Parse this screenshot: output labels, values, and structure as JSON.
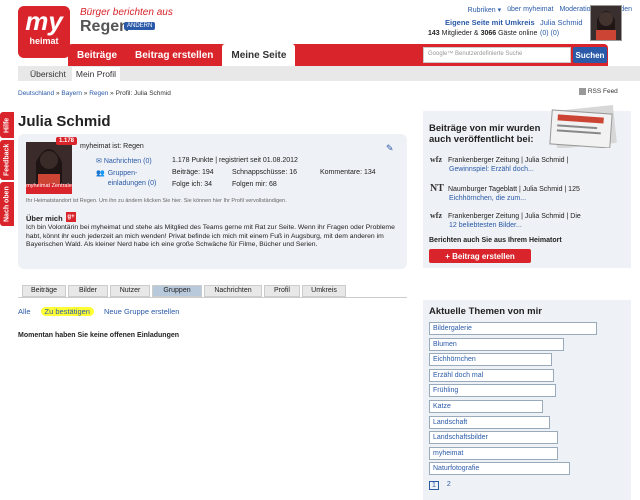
{
  "header": {
    "logo_my": "my",
    "logo_heimat": "heimat",
    "tagline": "Bürger berichten aus",
    "region": "Regen",
    "change_label": "ÄNDERN",
    "topnav": [
      "Rubriken ▾",
      "über myheimat",
      "Moderation",
      "Abmelden"
    ],
    "own_page": "Eigene Seite mit Umkreis",
    "stats_members": "143",
    "stats_members_label": "Mitglieder &",
    "stats_guests": "3066",
    "stats_guests_label": "Gäste online",
    "user_name": "Julia Schmid",
    "user_counts": "(0)   (0)"
  },
  "nav": {
    "items": [
      "Beiträge",
      "Beitrag erstellen",
      "Meine Seite"
    ],
    "active": 2,
    "search_placeholder": "Google™ Benutzerdefinierte Suche",
    "search_button": "Suchen"
  },
  "subnav": {
    "items": [
      "Übersicht",
      "Mein Profil"
    ]
  },
  "sidetabs": [
    "Hilfe",
    "Feedback",
    "Nach oben"
  ],
  "breadcrumb": [
    "Deutschland",
    "Bayern",
    "Regen",
    "Profil: Julia Schmid"
  ],
  "rss": "RSS Feed",
  "profile": {
    "name": "Julia Schmid",
    "badge": "1.178",
    "photo_caption": "myheimat Zentrale",
    "home": "myheimat ist: Regen",
    "messages": "Nachrichten (0)",
    "invites": "Gruppen-\neinladungen (0)",
    "punkte": "1.178 Punkte | registriert seit 01.08.2012",
    "beitraege": "Beiträge: 194",
    "schnapp": "Schnappschüsse: 16",
    "kommentare": "Kommentare: 134",
    "folge": "Folge ich: 34",
    "folgen": "Folgen mir: 68",
    "locinfo": "Ihr Heimatstandort ist Regen. Um ihn zu ändern klicken Sie hier. Sie können hier Ihr Profil vervollständigen.",
    "about_head": "Über mich",
    "about": "Ich bin Volontärin bei myheimat und stehe als Mitglied des Teams gerne mit Rat zur Seite. Wenn ihr Fragen oder Probleme habt, könnt ihr euch jederzeit an mich wenden! Privat befinde ich mich mit einem Fuß in Augsburg, mit dem anderen im Bayerischen Wald. Als kleiner Nerd habe ich eine große Schwäche für Filme, Bücher und Serien."
  },
  "tabs": {
    "items": [
      "Beiträge",
      "Bilder",
      "Nutzer",
      "Gruppen",
      "Nachrichten",
      "Profil",
      "Umkreis"
    ],
    "active": 3
  },
  "filters": {
    "items": [
      "Alle",
      "Zu bestätigen",
      "Neue Gruppe erstellen"
    ],
    "active": 1
  },
  "empty_message": "Momentan haben Sie keine offenen Einladungen",
  "published": {
    "title": "Beiträge von mir wurden auch veröffentlicht bei:",
    "items": [
      {
        "src": "wfz",
        "line1": "Frankenberger Zeitung | Julia Schmid |",
        "line2": "Gewinnspiel: Erzähl doch..."
      },
      {
        "src": "NT",
        "line1": "Naumburger Tageblatt | Julia Schmid | 125",
        "line2": "Eichhörnchen, die zum..."
      },
      {
        "src": "wfz",
        "line1": "Frankenberger Zeitung | Julia Schmid | Die",
        "line2": "12 beliebtesten Bilder..."
      }
    ],
    "footer": "Berichten auch Sie aus Ihrem Heimatort",
    "button": "+ Beitrag erstellen"
  },
  "topics": {
    "title": "Aktuelle Themen von mir",
    "items": [
      "Bildergalerie",
      "Blumen",
      "Eichhörnchen",
      "Erzähl doch mal",
      "Frühling",
      "Katze",
      "Landschaft",
      "Landschaftsbilder",
      "myheimat",
      "Naturfotografie"
    ],
    "widths": [
      0.81,
      0.65,
      0.59,
      0.6,
      0.61,
      0.55,
      0.58,
      0.62,
      0.62,
      0.68
    ],
    "pages": [
      "1",
      "2"
    ],
    "active_page": 0
  },
  "colors": {
    "brand_red": "#d8242a",
    "link_blue": "#2a5aa8",
    "panel_bg": "#eef1f5",
    "highlight": "#ffff33"
  }
}
